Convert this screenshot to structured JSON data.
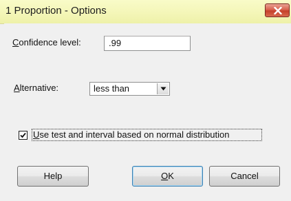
{
  "window": {
    "title": "1 Proportion - Options"
  },
  "form": {
    "confidence_level": {
      "label_underlined": "C",
      "label_rest": "onfidence level:",
      "value": ".99"
    },
    "alternative": {
      "label_underlined": "A",
      "label_rest": "lternative:",
      "selected": "less than"
    },
    "normal_distribution": {
      "checked": true,
      "label_underlined": "U",
      "label_rest": "se test and interval based on normal distribution"
    }
  },
  "buttons": {
    "help": "Help",
    "ok_underlined": "O",
    "ok_rest": "K",
    "cancel": "Cancel"
  },
  "icons": {
    "close": "close-icon",
    "dropdown": "chevron-down-icon",
    "check": "checkmark-icon"
  },
  "colors": {
    "titlebar": "#f4f6b8",
    "close_button": "#d8624f",
    "dialog_background": "#f0f0f0"
  }
}
